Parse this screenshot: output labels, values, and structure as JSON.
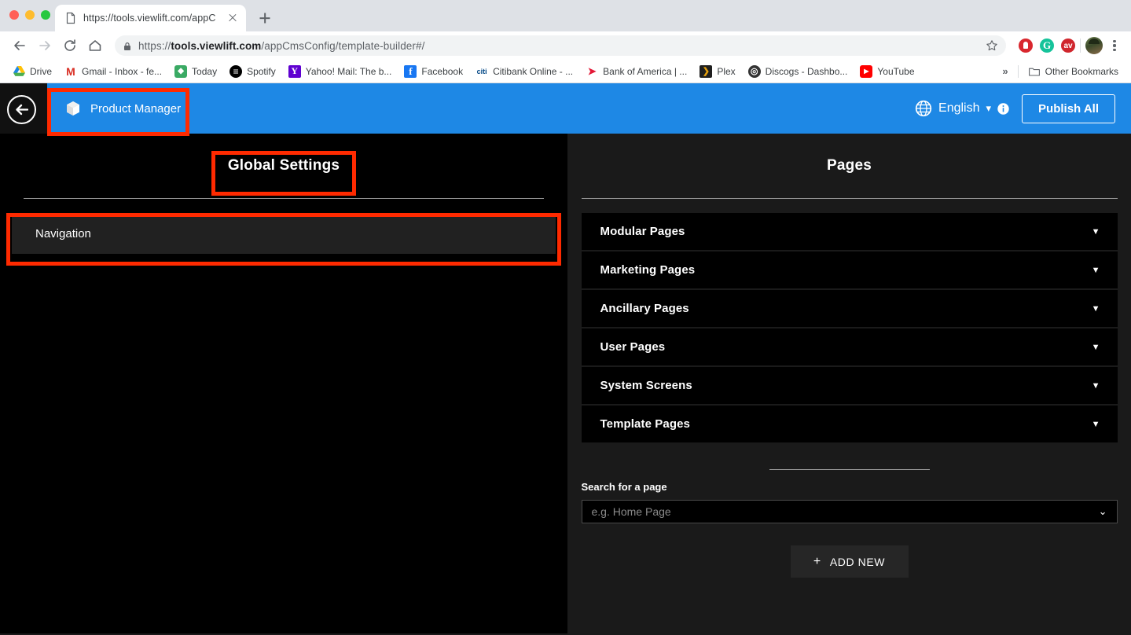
{
  "browser": {
    "tab": {
      "title": "https://tools.viewlift.com/appC",
      "favicon_icon": "page-icon",
      "close_icon": "close-icon"
    },
    "new_tab_icon": "plus-icon",
    "nav": {
      "back_icon": "arrow-left-icon",
      "forward_icon": "arrow-right-icon",
      "reload_icon": "reload-icon",
      "home_icon": "home-icon"
    },
    "omnibox": {
      "lock_icon": "lock-icon",
      "scheme": "https://",
      "host": "tools.viewlift.com",
      "path": "/appCmsConfig/template-builder#/",
      "star_icon": "star-icon"
    },
    "extensions": [
      {
        "name": "adblock-icon",
        "label": ""
      },
      {
        "name": "grammarly-icon",
        "label": "G"
      },
      {
        "name": "avast-icon",
        "label": "av"
      }
    ],
    "avatar_icon": "avatar",
    "menu_icon": "kebab-menu-icon",
    "bookmarks": [
      {
        "label": "Drive",
        "icon": "drive-icon",
        "glyph": ""
      },
      {
        "label": "Gmail - Inbox - fe...",
        "icon": "gmail-icon",
        "glyph": "M"
      },
      {
        "label": "Today",
        "icon": "feedly-icon",
        "glyph": "◆"
      },
      {
        "label": "Spotify",
        "icon": "spotify-icon",
        "glyph": "≡"
      },
      {
        "label": "Yahoo! Mail: The b...",
        "icon": "yahoo-icon",
        "glyph": "Y"
      },
      {
        "label": "Facebook",
        "icon": "facebook-icon",
        "glyph": "f"
      },
      {
        "label": "Citibank Online - ...",
        "icon": "citi-icon",
        "glyph": "citi"
      },
      {
        "label": "Bank of America | ...",
        "icon": "boa-icon",
        "glyph": "➤"
      },
      {
        "label": "Plex",
        "icon": "plex-icon",
        "glyph": "❯"
      },
      {
        "label": "Discogs - Dashbo...",
        "icon": "discogs-icon",
        "glyph": "◎"
      },
      {
        "label": "YouTube",
        "icon": "youtube-icon",
        "glyph": "▶"
      }
    ],
    "overflow_chevron": "»",
    "other_bookmarks": {
      "label": "Other Bookmarks",
      "icon": "folder-icon",
      "glyph": "🗀"
    }
  },
  "app_header": {
    "back_icon": "arrow-left-circle-icon",
    "product_tab": {
      "label": "Product Manager",
      "icon": "cube-icon"
    },
    "language": {
      "icon": "globe-icon",
      "label": "English",
      "caret": "▾",
      "info_icon": "info-icon"
    },
    "publish_button": "Publish All",
    "accent_color": "#1e88e5"
  },
  "left_panel": {
    "title": "Global Settings",
    "items": [
      {
        "label": "Navigation"
      }
    ]
  },
  "right_panel": {
    "title": "Pages",
    "accordions": [
      {
        "label": "Modular Pages",
        "caret": "▼"
      },
      {
        "label": "Marketing Pages",
        "caret": "▼"
      },
      {
        "label": "Ancillary Pages",
        "caret": "▼"
      },
      {
        "label": "User Pages",
        "caret": "▼"
      },
      {
        "label": "System Screens",
        "caret": "▼"
      },
      {
        "label": "Template Pages",
        "caret": "▼"
      }
    ],
    "search": {
      "label": "Search for a page",
      "value": "",
      "placeholder": "e.g. Home Page",
      "caret": "⌄"
    },
    "add_new": {
      "label": "ADD NEW",
      "plus": "+"
    }
  },
  "annotations": {
    "color": "#ff2a00",
    "boxes": [
      {
        "name": "product-manager-highlight"
      },
      {
        "name": "global-settings-highlight"
      },
      {
        "name": "navigation-highlight"
      }
    ]
  }
}
